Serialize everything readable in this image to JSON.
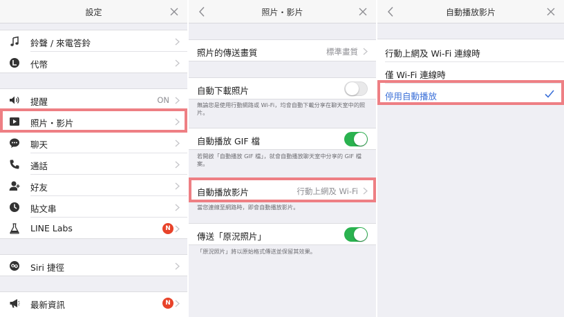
{
  "colors": {
    "highlight": "#ee7f84",
    "toggle_on": "#2ab24f",
    "selected_text": "#3a6fd8",
    "badge": "#e8432a"
  },
  "settings": {
    "title": "設定",
    "items": [
      {
        "label": "鈴聲 / 來電答鈴",
        "icon": "music-note-icon"
      },
      {
        "label": "代幣",
        "icon": "coin-icon"
      },
      {
        "label": "提醒",
        "icon": "speaker-icon",
        "value": "ON"
      },
      {
        "label": "照片・影片",
        "icon": "play-icon"
      },
      {
        "label": "聊天",
        "icon": "chat-bubble-icon"
      },
      {
        "label": "通話",
        "icon": "phone-icon"
      },
      {
        "label": "好友",
        "icon": "person-add-icon"
      },
      {
        "label": "貼文串",
        "icon": "clock-icon"
      },
      {
        "label": "LINE Labs",
        "icon": "flask-icon",
        "badge": "N"
      },
      {
        "label": "Siri 捷徑",
        "icon": "siri-icon"
      },
      {
        "label": "最新資訊",
        "icon": "megaphone-icon",
        "badge": "N"
      }
    ]
  },
  "photos": {
    "title": "照片・影片",
    "transfer_quality_label": "照片的傳送畫質",
    "transfer_quality_value": "標準畫質",
    "auto_download_label": "自動下載照片",
    "auto_download_on": false,
    "auto_download_note": "無論您是使用行動網路或 Wi-Fi，均會自動下載分享在聊天室中的照片。",
    "autoplay_gif_label": "自動播放 GIF 檔",
    "autoplay_gif_on": true,
    "autoplay_gif_note": "若開啟「自動播放 GIF 檔」，就會自動播放聊天室中分享的 GIF 檔案。",
    "autoplay_video_label": "自動播放影片",
    "autoplay_video_value": "行動上網及 Wi-Fi",
    "autoplay_video_note": "當您連線至網路時，即會自動播放影片。",
    "live_photo_label": "傳送「原況照片」",
    "live_photo_on": true,
    "live_photo_note": "「原況照片」將以原始格式傳送並保留其效果。"
  },
  "autoplay": {
    "title": "自動播放影片",
    "options": [
      {
        "label": "行動上網及 Wi-Fi 連線時"
      },
      {
        "label": "僅 Wi-Fi 連線時"
      },
      {
        "label": "停用自動播放",
        "selected": true
      }
    ]
  }
}
